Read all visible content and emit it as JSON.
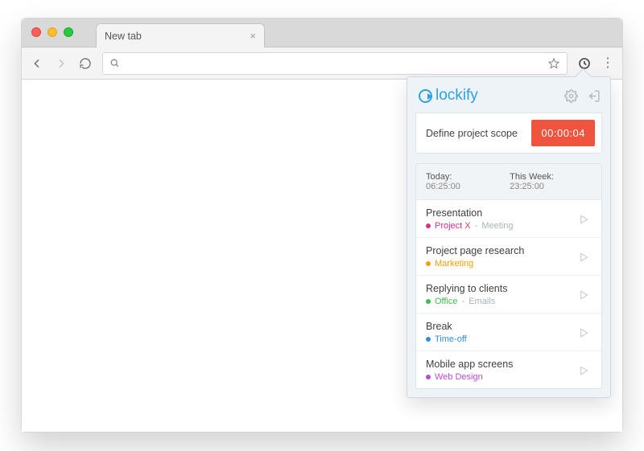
{
  "browser": {
    "tab_title": "New tab",
    "address_value": ""
  },
  "popup": {
    "brand": "lockify",
    "timer": {
      "description": "Define project scope",
      "elapsed": "00:00:04"
    },
    "summary": {
      "today_label": "Today:",
      "today_value": "06:25:00",
      "week_label": "This Week:",
      "week_value": "23:25:00"
    },
    "entries": [
      {
        "title": "Presentation",
        "project": "Project X",
        "project_color": "#d63384",
        "task": "Meeting"
      },
      {
        "title": "Project page research",
        "project": "Marketing",
        "project_color": "#f0a000",
        "task": ""
      },
      {
        "title": "Replying to clients",
        "project": "Office",
        "project_color": "#3fbf4a",
        "task": "Emails"
      },
      {
        "title": "Break",
        "project": "Time-off",
        "project_color": "#2f8fd8",
        "task": ""
      },
      {
        "title": "Mobile app screens",
        "project": "Web Design",
        "project_color": "#b94bd6",
        "task": ""
      }
    ]
  }
}
